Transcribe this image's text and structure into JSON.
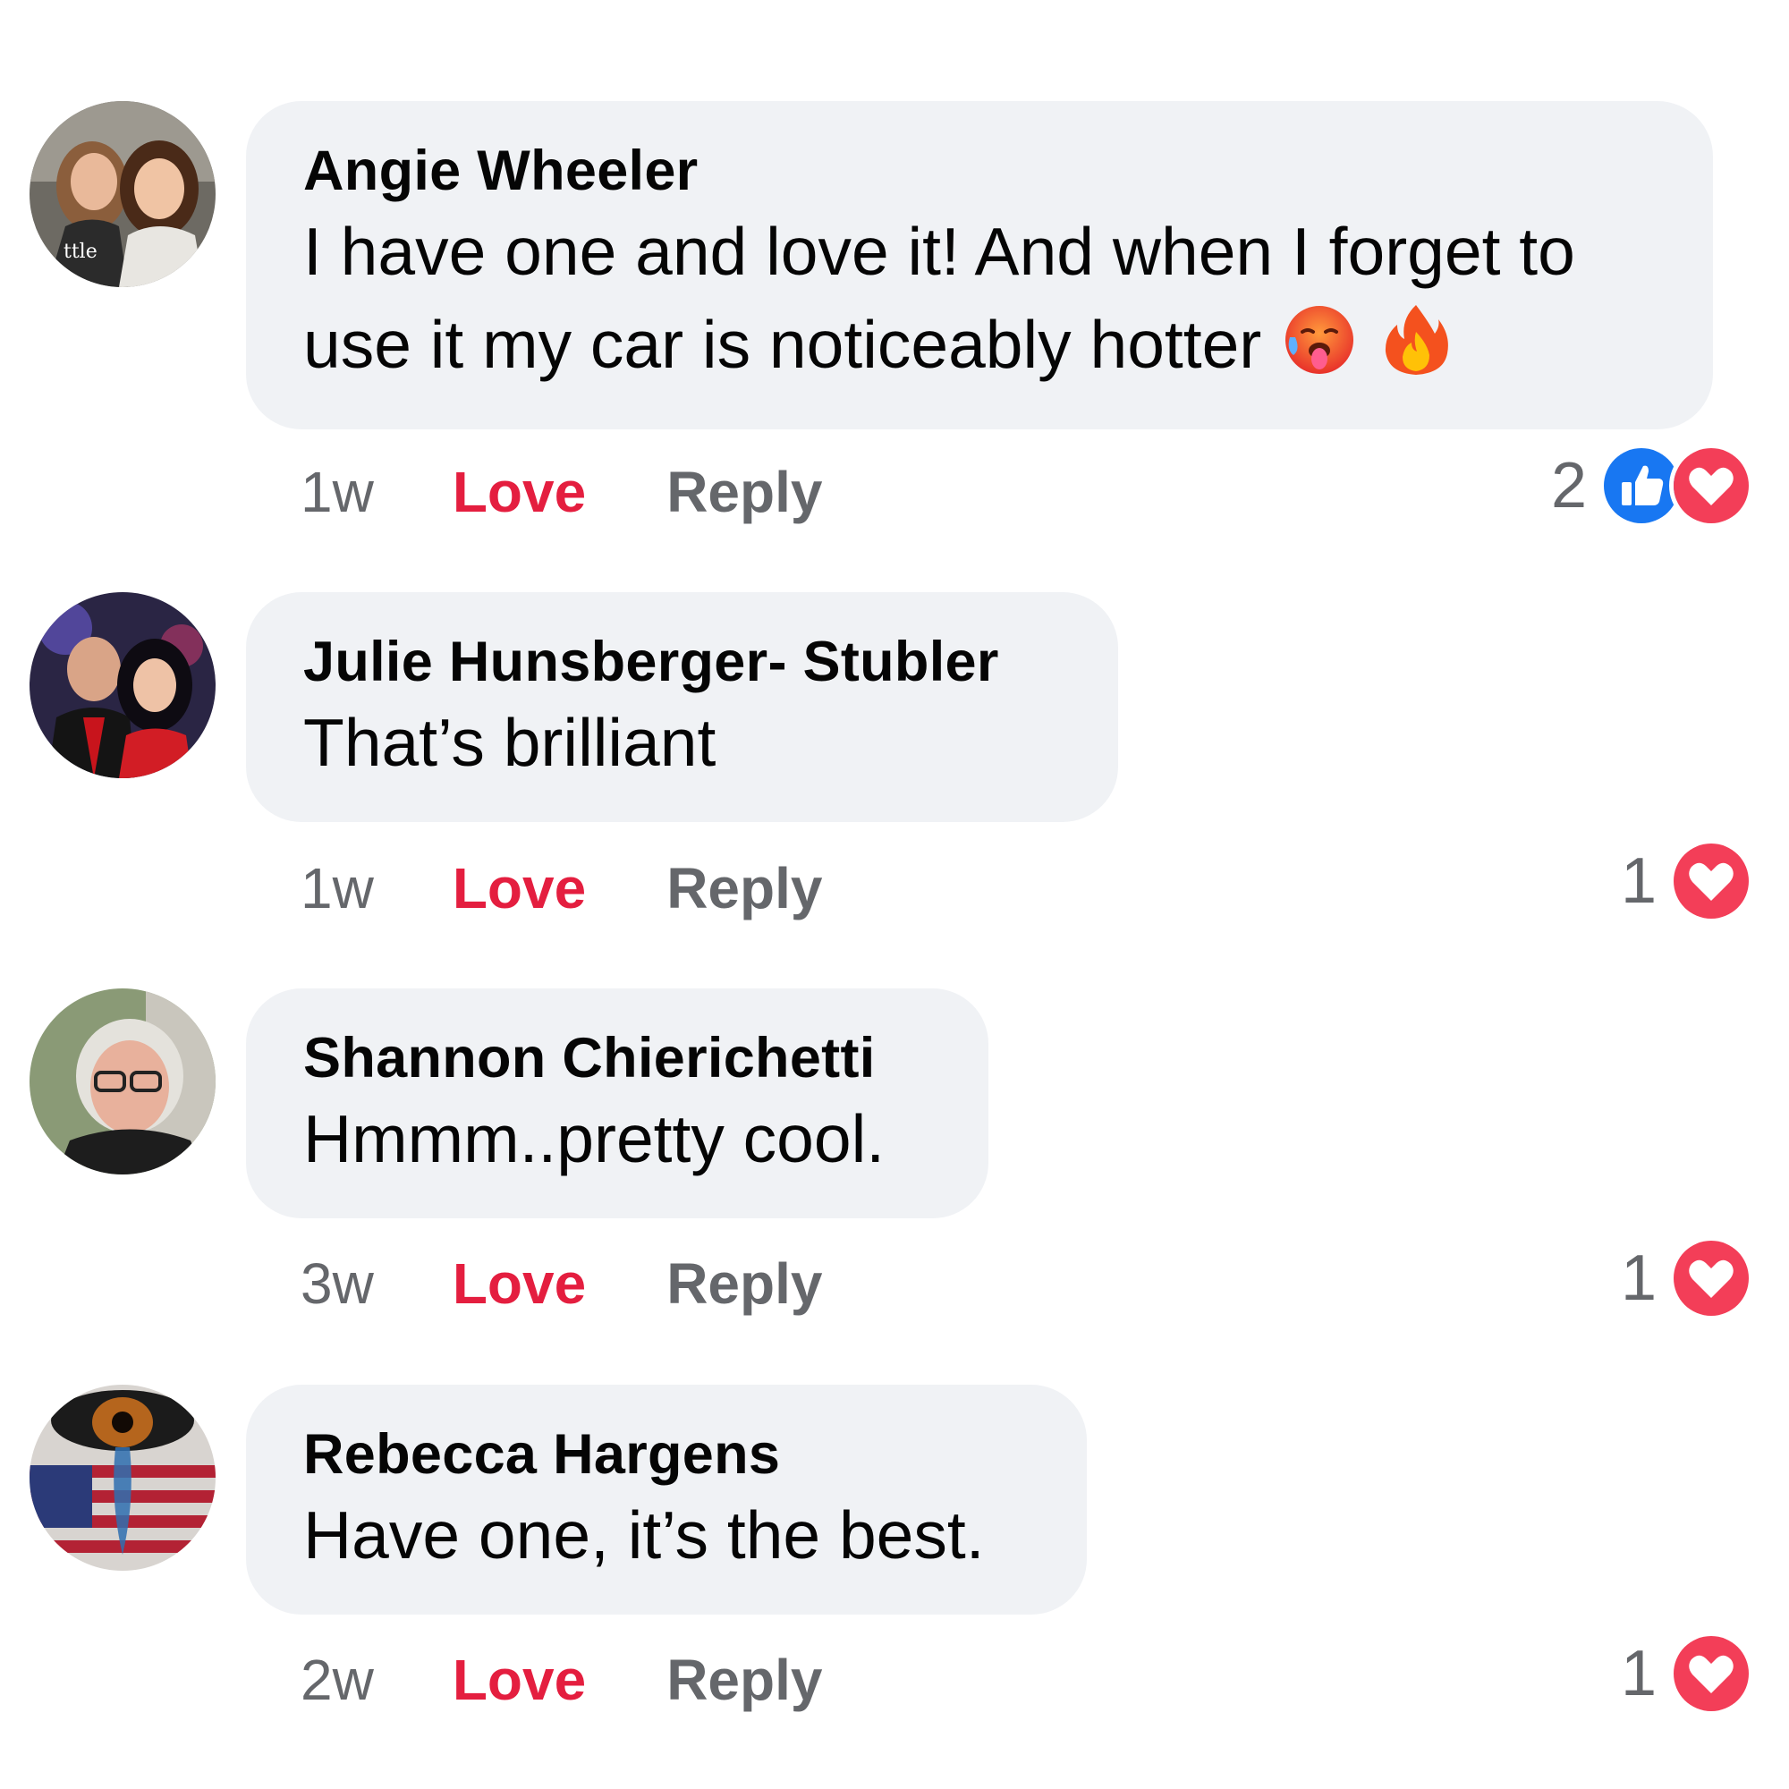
{
  "comments": [
    {
      "author": "Angie Wheeler",
      "text": "I have one and love it! And when I forget to use it my car is noticeably hotter",
      "emojis": [
        "hot-face-emoji",
        "fire-emoji"
      ],
      "time": "1w",
      "love_label": "Love",
      "reply_label": "Reply",
      "reaction_count": "2",
      "reaction_icons": [
        "like-icon",
        "love-icon"
      ]
    },
    {
      "author": "Julie Hunsberger- Stubler",
      "text": "That’s brilliant",
      "time": "1w",
      "love_label": "Love",
      "reply_label": "Reply",
      "reaction_count": "1",
      "reaction_icons": [
        "love-icon"
      ]
    },
    {
      "author": "Shannon Chierichetti",
      "text": "Hmmm..pretty cool.",
      "time": "3w",
      "love_label": "Love",
      "reply_label": "Reply",
      "reaction_count": "1",
      "reaction_icons": [
        "love-icon"
      ]
    },
    {
      "author": "Rebecca Hargens",
      "text": "Have one, it’s the best.",
      "time": "2w",
      "love_label": "Love",
      "reply_label": "Reply",
      "reaction_count": "1",
      "reaction_icons": [
        "love-icon"
      ]
    }
  ],
  "colors": {
    "bubble": "#f0f2f5",
    "love": "#e41e3f",
    "secondary_text": "#65676b",
    "like_blue": "#1877f2",
    "love_red": "#f33e58"
  }
}
